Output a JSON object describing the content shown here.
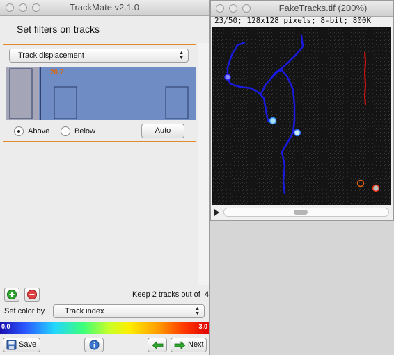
{
  "trackmate": {
    "title": "TrackMate v2.1.0",
    "panel_title": "Set filters on tracks",
    "filter": {
      "feature": "Track displacement",
      "threshold": "20.7",
      "above_label": "Above",
      "below_label": "Below",
      "selected": "above",
      "auto_label": "Auto",
      "accent_color": "#e08a2a",
      "histogram_color": "#6f8cc4"
    },
    "summary": "Keep 2 tracks out of  4.",
    "color_by_label": "Set color by",
    "color_by_value": "Track index",
    "colorbar": {
      "min": "0.0",
      "max": "3.0"
    },
    "footer": {
      "save_label": "Save",
      "next_label": "Next"
    }
  },
  "image_window": {
    "title": "FakeTracks.tif (200%)",
    "info": "23/50; 128x128 pixels; 8-bit; 800K",
    "track_color_kept": "#1a1adf",
    "track_color_filtered": "#e01010"
  }
}
